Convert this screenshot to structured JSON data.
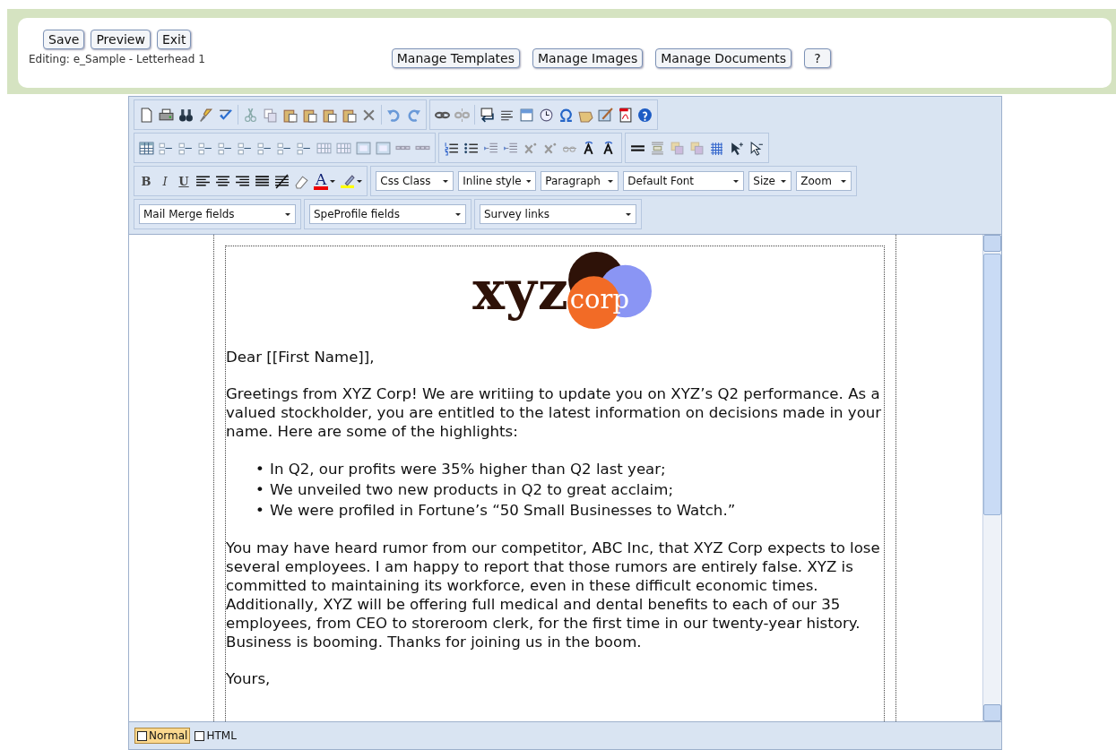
{
  "top_bar": {
    "buttons": [
      "Save",
      "Preview",
      "Exit"
    ],
    "editing_label": "Editing: e_Sample - Letterhead 1",
    "manage_buttons": [
      "Manage Templates",
      "Manage Images",
      "Manage Documents"
    ],
    "help_button": "?"
  },
  "toolbar": {
    "format_letters": [
      "B",
      "I",
      "U"
    ],
    "font_color_letter": "A",
    "style_dropdowns": [
      {
        "value": "Css Class",
        "kind": "narrow"
      },
      {
        "value": "Inline style",
        "kind": "narrow"
      },
      {
        "value": "Paragraph",
        "kind": "narrow"
      },
      {
        "value": "Default Font",
        "kind": "wide"
      },
      {
        "value": "Size",
        "kind": "small"
      },
      {
        "value": "Zoom",
        "kind": "small"
      }
    ],
    "field_dropdowns": [
      "Mail Merge fields",
      "SpeProfile fields",
      "Survey links"
    ]
  },
  "document": {
    "logo": {
      "wordmark": "xyz",
      "badge": "corp"
    },
    "salutation": "Dear [[First Name]],",
    "intro": "Greetings from XYZ Corp! We are writiing to update you on XYZ’s Q2 performance. As a valued stockholder, you are entitled to the latest information on decisions made in your name. Here are some of the highlights:",
    "bullets": [
      {
        "marker": "•",
        "text": "In Q2, our profits were 35% higher than Q2 last year;"
      },
      {
        "marker": "•",
        "text": "We unveiled two new products in Q2 to great acclaim;"
      },
      {
        "marker": "•",
        "text": "We were profiled in Fortune’s “50 Small Businesses to Watch.”"
      }
    ],
    "body": "You may have heard rumor from our competitor, ABC Inc, that XYZ Corp expects to lose several employees. I am happy to report that those rumors are entirely false. XYZ is committed to maintaining its workforce, even in these difficult economic times. Additionally, XYZ will be offering full medical and dental benefits to each of our 35 employees, from CEO to storeroom clerk, for the first time in our twenty-year history. Business is booming. Thanks for joining us in the boom.",
    "closing": "Yours,"
  },
  "modes": [
    {
      "label": "Normal",
      "selected": true
    },
    {
      "label": "HTML",
      "selected": false
    }
  ]
}
